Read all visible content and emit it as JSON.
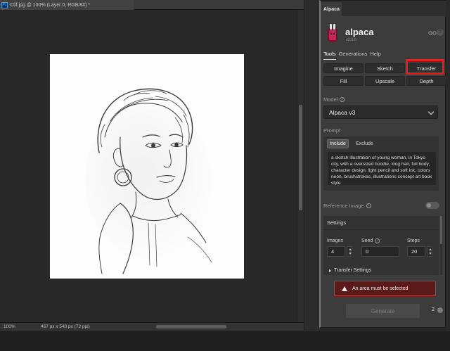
{
  "document": {
    "tab_title": "Ctif.jpg @ 100% (Layer 0, RGB/8#) *",
    "ps_badge": "Ps",
    "zoom": "100%",
    "doc_size": "467 px x 540 px (72 ppi)"
  },
  "panel": {
    "tab_label": "Alpaca",
    "app_name": "alpaca",
    "version": "v2.5.0",
    "help_glyph": "?",
    "nav_tabs": [
      "Tools",
      "Generations",
      "Help"
    ],
    "tools": [
      "Imagine",
      "Sketch",
      "Transfer",
      "Fill",
      "Upscale",
      "Depth"
    ],
    "model_label": "Model",
    "model_value": "Alpaca v3",
    "prompt_label": "Prompt",
    "include_label": "Include",
    "exclude_label": "Exclude",
    "prompt_text": "a sketch illustration of young woman, in Tokyo city, with a oversized hoodie, long hair, full body, character design, light pencil and soft ink, colors neon, brushstrokes, illustrations concept art book style",
    "reference_label": "Reference Image",
    "settings_label": "Settings",
    "images_label": "Images",
    "images_value": "4",
    "seed_label": "Seed",
    "seed_value": "0",
    "steps_label": "Steps",
    "steps_value": "20",
    "transfer_settings_label": "Transfer Settings",
    "alert_text": "An area must be selected",
    "generate_label": "Generate",
    "credits": "2"
  },
  "colors": {
    "highlight": "#e21e1e",
    "alert_bg": "#5a1a1a",
    "ps_blue": "#31a8ff"
  }
}
